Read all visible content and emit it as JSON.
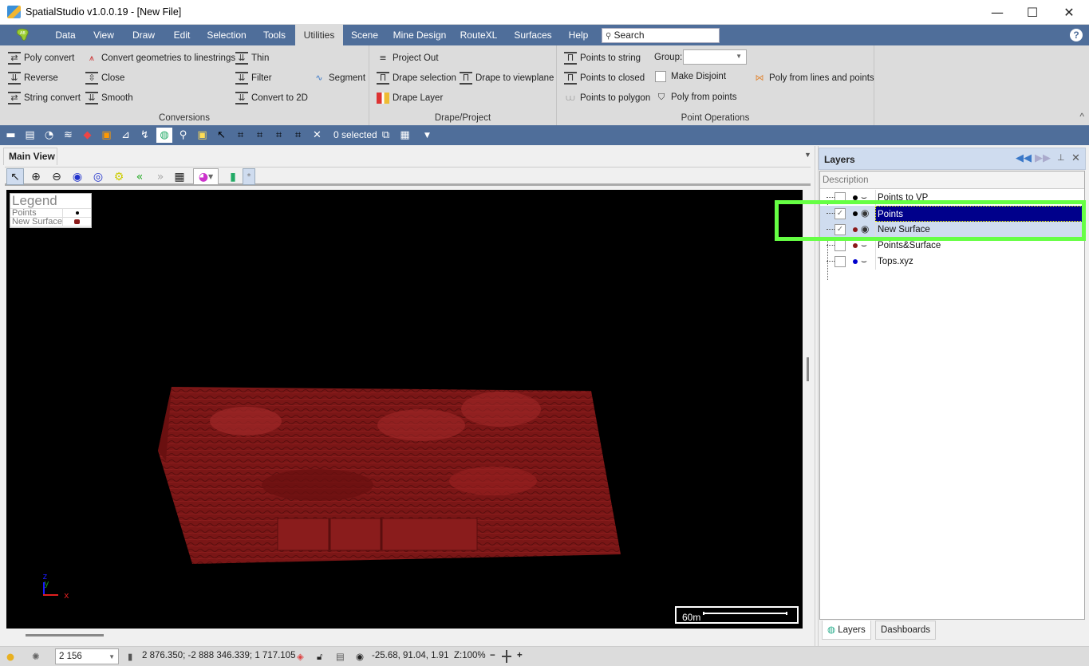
{
  "window": {
    "title": "SpatialStudio v1.0.0.19 - [New File]",
    "minimize_glyph": "—",
    "maximize_glyph": "☐",
    "close_glyph": "✕"
  },
  "menu": {
    "logo_label": "AB",
    "items": [
      "Data",
      "View",
      "Draw",
      "Edit",
      "Selection",
      "Tools",
      "Utilities",
      "Scene",
      "Mine Design",
      "RouteXL",
      "Surfaces",
      "Help"
    ],
    "active": "Utilities",
    "search_placeholder": "Search",
    "help_glyph": "?"
  },
  "ribbon": {
    "groups": [
      {
        "label": "Conversions",
        "buttons": [
          "Poly convert",
          "Convert geometries to linestrings",
          "Thin",
          "Reverse",
          "Close",
          "Filter",
          "Segment",
          "String convert",
          "Smooth",
          "Convert to 2D"
        ]
      },
      {
        "label": "Drape/Project",
        "buttons": [
          "Project Out",
          "Drape selection",
          "Drape to viewplane",
          "Drape Layer"
        ]
      },
      {
        "label": "Point Operations",
        "buttons": [
          "Points to string",
          "Points to closed",
          "Points to  polygon",
          "Make Disjoint",
          "Poly from points",
          "Poly from lines and points"
        ],
        "group_field_label": "Group:",
        "group_field_value": "",
        "make_disjoint_checked": false
      }
    ],
    "collapse_glyph": "^"
  },
  "toolbar": {
    "selected_text": "0 selected"
  },
  "main_view": {
    "tab_label": "Main View",
    "legend": {
      "title": "Legend",
      "items": [
        {
          "name": "Points",
          "color": "#000000"
        },
        {
          "name": "New Surface",
          "color": "#8b1a1a"
        }
      ]
    },
    "scale_label": "60m",
    "axis_labels": {
      "x": "x",
      "y": "y",
      "z": "z"
    },
    "surface_color": "#8b1a1a",
    "point_color": "#9b9b9b"
  },
  "layers_panel": {
    "title": "Layers",
    "column_header": "Description",
    "layers": [
      {
        "name": "Points to VP",
        "checked": false,
        "visible": false,
        "color": "#000000"
      },
      {
        "name": "Points",
        "checked": true,
        "visible": true,
        "color": "#000000",
        "selected": true
      },
      {
        "name": "New Surface",
        "checked": true,
        "visible": true,
        "color": "#8b1a1a"
      },
      {
        "name": "Points&Surface",
        "checked": false,
        "visible": false,
        "color": "#8b1a1a"
      },
      {
        "name": "Tops.xyz",
        "checked": false,
        "visible": false,
        "color": "#0000cc"
      }
    ],
    "bottom_tabs": [
      "Layers",
      "Dashboards"
    ]
  },
  "status_bar": {
    "zoom_value": "2 156",
    "cursor_coords": "2 876.350; -2 888 346.339; 1 717.105",
    "view_angles": "-25.68, 91.04, 1.91",
    "z_zoom": "Z:100%",
    "minus": "−",
    "plus": "+"
  },
  "highlight_color": "#66ff44"
}
